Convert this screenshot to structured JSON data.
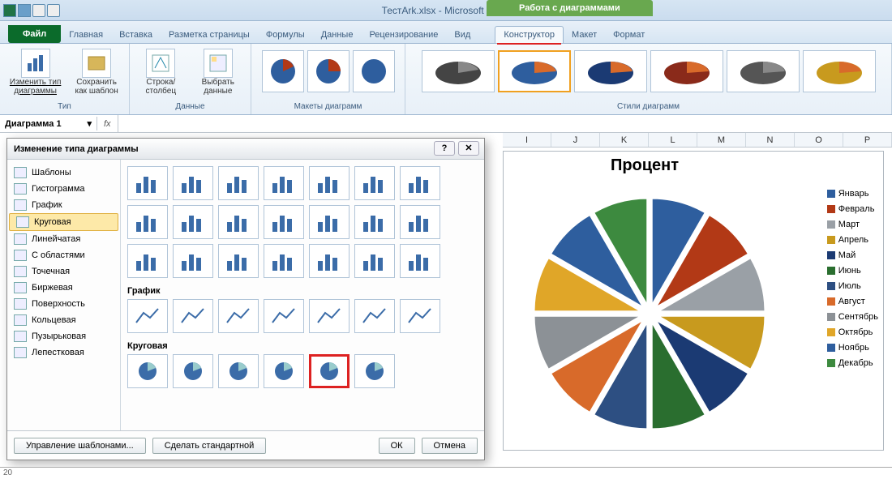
{
  "app": {
    "title": "ТестArk.xlsx - Microsoft Excel",
    "chart_tools_label": "Работа с диаграммами"
  },
  "tabs": {
    "file": "Файл",
    "items": [
      "Главная",
      "Вставка",
      "Разметка страницы",
      "Формулы",
      "Данные",
      "Рецензирование",
      "Вид"
    ],
    "chart": [
      "Конструктор",
      "Макет",
      "Формат"
    ],
    "active": "Конструктор"
  },
  "ribbon": {
    "group_type_label": "Тип",
    "change_type": "Изменить тип диаграммы",
    "save_template": "Сохранить как шаблон",
    "group_data_label": "Данные",
    "row_col": "Строка/столбец",
    "select_data": "Выбрать данные",
    "group_layouts_label": "Макеты диаграмм",
    "group_styles_label": "Стили диаграмм"
  },
  "namebox": "Диаграмма 1",
  "fx": "fx",
  "columns": [
    "I",
    "J",
    "K",
    "L",
    "M",
    "N",
    "O",
    "P"
  ],
  "chart": {
    "title": "Процент",
    "legend": [
      {
        "label": "Январь",
        "color": "#2e5e9e"
      },
      {
        "label": "Февраль",
        "color": "#b23916"
      },
      {
        "label": "Март",
        "color": "#9aa0a6"
      },
      {
        "label": "Апрель",
        "color": "#c89a1e"
      },
      {
        "label": "Май",
        "color": "#1b3a73"
      },
      {
        "label": "Июнь",
        "color": "#2a6e2f"
      },
      {
        "label": "Июль",
        "color": "#2d4f82"
      },
      {
        "label": "Август",
        "color": "#d86a2a"
      },
      {
        "label": "Сентябрь",
        "color": "#8c9196"
      },
      {
        "label": "Октябрь",
        "color": "#e0a628"
      },
      {
        "label": "Ноябрь",
        "color": "#2e5e9e"
      },
      {
        "label": "Декабрь",
        "color": "#3d8a3f"
      }
    ]
  },
  "chart_data": {
    "type": "pie",
    "title": "Процент",
    "categories": [
      "Январь",
      "Февраль",
      "Март",
      "Апрель",
      "Май",
      "Июнь",
      "Июль",
      "Август",
      "Сентябрь",
      "Октябрь",
      "Ноябрь",
      "Декабрь"
    ],
    "values": [
      1,
      1,
      1,
      1,
      1,
      1,
      1,
      1,
      1,
      1,
      1,
      1
    ],
    "note": "12 visually equal exploded 3D pie slices; numeric values not labeled on chart"
  },
  "dialog": {
    "title": "Изменение типа диаграммы",
    "side": [
      "Шаблоны",
      "Гистограмма",
      "График",
      "Круговая",
      "Линейчатая",
      "С областями",
      "Точечная",
      "Биржевая",
      "Поверхность",
      "Кольцевая",
      "Пузырьковая",
      "Лепестковая"
    ],
    "side_selected": "Круговая",
    "sec_line": "График",
    "sec_pie": "Круговая",
    "manage_templates": "Управление шаблонами...",
    "make_default": "Сделать стандартной",
    "ok": "ОК",
    "cancel": "Отмена"
  },
  "row_label_bottom": "20"
}
